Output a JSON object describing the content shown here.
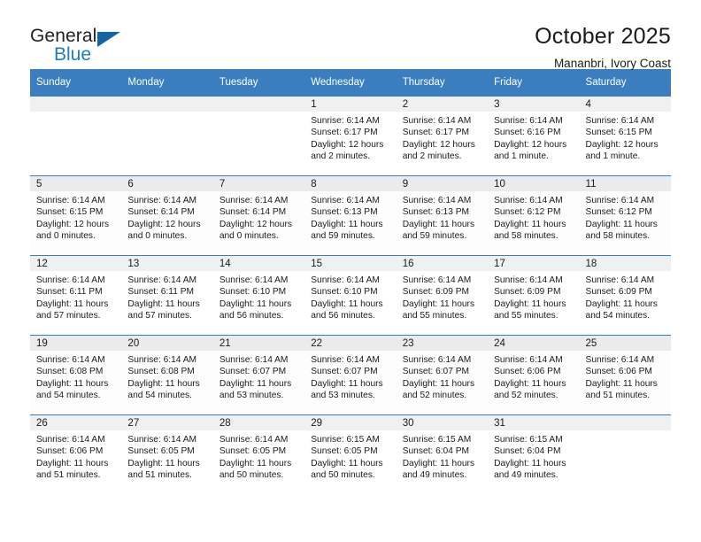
{
  "brand": {
    "line1": "General",
    "line2": "Blue",
    "flag_color": "#1464a5"
  },
  "header": {
    "title": "October 2025",
    "subtitle": "Mananbri, Ivory Coast"
  },
  "colors": {
    "header_blue": "#3a7ebf",
    "daynum_band": "#f0f0f0",
    "text": "#1a1a1a"
  },
  "labels": {
    "sunrise_prefix": "Sunrise:",
    "sunset_prefix": "Sunset:",
    "daylight_prefix": "Daylight:"
  },
  "weekday_headers": [
    "Sunday",
    "Monday",
    "Tuesday",
    "Wednesday",
    "Thursday",
    "Friday",
    "Saturday"
  ],
  "weeks": [
    [
      {
        "day": ""
      },
      {
        "day": ""
      },
      {
        "day": ""
      },
      {
        "day": "1",
        "sunrise": "Sunrise: 6:14 AM",
        "sunset": "Sunset: 6:17 PM",
        "daylight": "Daylight: 12 hours and 2 minutes."
      },
      {
        "day": "2",
        "sunrise": "Sunrise: 6:14 AM",
        "sunset": "Sunset: 6:17 PM",
        "daylight": "Daylight: 12 hours and 2 minutes."
      },
      {
        "day": "3",
        "sunrise": "Sunrise: 6:14 AM",
        "sunset": "Sunset: 6:16 PM",
        "daylight": "Daylight: 12 hours and 1 minute."
      },
      {
        "day": "4",
        "sunrise": "Sunrise: 6:14 AM",
        "sunset": "Sunset: 6:15 PM",
        "daylight": "Daylight: 12 hours and 1 minute."
      }
    ],
    [
      {
        "day": "5",
        "sunrise": "Sunrise: 6:14 AM",
        "sunset": "Sunset: 6:15 PM",
        "daylight": "Daylight: 12 hours and 0 minutes."
      },
      {
        "day": "6",
        "sunrise": "Sunrise: 6:14 AM",
        "sunset": "Sunset: 6:14 PM",
        "daylight": "Daylight: 12 hours and 0 minutes."
      },
      {
        "day": "7",
        "sunrise": "Sunrise: 6:14 AM",
        "sunset": "Sunset: 6:14 PM",
        "daylight": "Daylight: 12 hours and 0 minutes."
      },
      {
        "day": "8",
        "sunrise": "Sunrise: 6:14 AM",
        "sunset": "Sunset: 6:13 PM",
        "daylight": "Daylight: 11 hours and 59 minutes."
      },
      {
        "day": "9",
        "sunrise": "Sunrise: 6:14 AM",
        "sunset": "Sunset: 6:13 PM",
        "daylight": "Daylight: 11 hours and 59 minutes."
      },
      {
        "day": "10",
        "sunrise": "Sunrise: 6:14 AM",
        "sunset": "Sunset: 6:12 PM",
        "daylight": "Daylight: 11 hours and 58 minutes."
      },
      {
        "day": "11",
        "sunrise": "Sunrise: 6:14 AM",
        "sunset": "Sunset: 6:12 PM",
        "daylight": "Daylight: 11 hours and 58 minutes."
      }
    ],
    [
      {
        "day": "12",
        "sunrise": "Sunrise: 6:14 AM",
        "sunset": "Sunset: 6:11 PM",
        "daylight": "Daylight: 11 hours and 57 minutes."
      },
      {
        "day": "13",
        "sunrise": "Sunrise: 6:14 AM",
        "sunset": "Sunset: 6:11 PM",
        "daylight": "Daylight: 11 hours and 57 minutes."
      },
      {
        "day": "14",
        "sunrise": "Sunrise: 6:14 AM",
        "sunset": "Sunset: 6:10 PM",
        "daylight": "Daylight: 11 hours and 56 minutes."
      },
      {
        "day": "15",
        "sunrise": "Sunrise: 6:14 AM",
        "sunset": "Sunset: 6:10 PM",
        "daylight": "Daylight: 11 hours and 56 minutes."
      },
      {
        "day": "16",
        "sunrise": "Sunrise: 6:14 AM",
        "sunset": "Sunset: 6:09 PM",
        "daylight": "Daylight: 11 hours and 55 minutes."
      },
      {
        "day": "17",
        "sunrise": "Sunrise: 6:14 AM",
        "sunset": "Sunset: 6:09 PM",
        "daylight": "Daylight: 11 hours and 55 minutes."
      },
      {
        "day": "18",
        "sunrise": "Sunrise: 6:14 AM",
        "sunset": "Sunset: 6:09 PM",
        "daylight": "Daylight: 11 hours and 54 minutes."
      }
    ],
    [
      {
        "day": "19",
        "sunrise": "Sunrise: 6:14 AM",
        "sunset": "Sunset: 6:08 PM",
        "daylight": "Daylight: 11 hours and 54 minutes."
      },
      {
        "day": "20",
        "sunrise": "Sunrise: 6:14 AM",
        "sunset": "Sunset: 6:08 PM",
        "daylight": "Daylight: 11 hours and 54 minutes."
      },
      {
        "day": "21",
        "sunrise": "Sunrise: 6:14 AM",
        "sunset": "Sunset: 6:07 PM",
        "daylight": "Daylight: 11 hours and 53 minutes."
      },
      {
        "day": "22",
        "sunrise": "Sunrise: 6:14 AM",
        "sunset": "Sunset: 6:07 PM",
        "daylight": "Daylight: 11 hours and 53 minutes."
      },
      {
        "day": "23",
        "sunrise": "Sunrise: 6:14 AM",
        "sunset": "Sunset: 6:07 PM",
        "daylight": "Daylight: 11 hours and 52 minutes."
      },
      {
        "day": "24",
        "sunrise": "Sunrise: 6:14 AM",
        "sunset": "Sunset: 6:06 PM",
        "daylight": "Daylight: 11 hours and 52 minutes."
      },
      {
        "day": "25",
        "sunrise": "Sunrise: 6:14 AM",
        "sunset": "Sunset: 6:06 PM",
        "daylight": "Daylight: 11 hours and 51 minutes."
      }
    ],
    [
      {
        "day": "26",
        "sunrise": "Sunrise: 6:14 AM",
        "sunset": "Sunset: 6:06 PM",
        "daylight": "Daylight: 11 hours and 51 minutes."
      },
      {
        "day": "27",
        "sunrise": "Sunrise: 6:14 AM",
        "sunset": "Sunset: 6:05 PM",
        "daylight": "Daylight: 11 hours and 51 minutes."
      },
      {
        "day": "28",
        "sunrise": "Sunrise: 6:14 AM",
        "sunset": "Sunset: 6:05 PM",
        "daylight": "Daylight: 11 hours and 50 minutes."
      },
      {
        "day": "29",
        "sunrise": "Sunrise: 6:15 AM",
        "sunset": "Sunset: 6:05 PM",
        "daylight": "Daylight: 11 hours and 50 minutes."
      },
      {
        "day": "30",
        "sunrise": "Sunrise: 6:15 AM",
        "sunset": "Sunset: 6:04 PM",
        "daylight": "Daylight: 11 hours and 49 minutes."
      },
      {
        "day": "31",
        "sunrise": "Sunrise: 6:15 AM",
        "sunset": "Sunset: 6:04 PM",
        "daylight": "Daylight: 11 hours and 49 minutes."
      },
      {
        "day": ""
      }
    ]
  ]
}
